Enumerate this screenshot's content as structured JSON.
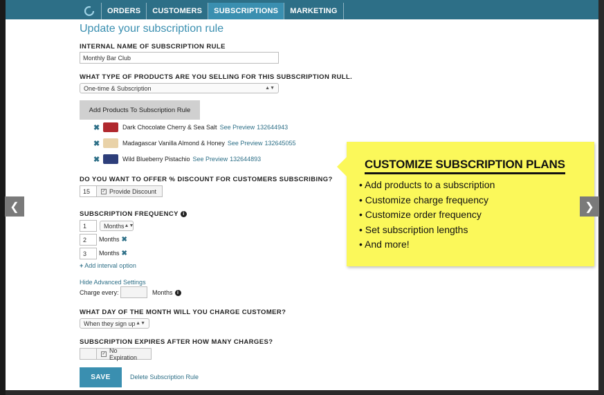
{
  "nav": {
    "items": [
      "ORDERS",
      "CUSTOMERS",
      "SUBSCRIPTIONS",
      "MARKETING"
    ],
    "active": "SUBSCRIPTIONS"
  },
  "page": {
    "title": "Update your subscription rule"
  },
  "form": {
    "internal_name_label": "INTERNAL NAME OF SUBSCRIPTION RULE",
    "internal_name_value": "Monthly Bar Club",
    "product_type_label": "WHAT TYPE OF PRODUCTS ARE YOU SELLING FOR THIS SUBSCRIPTION RULL.",
    "product_type_value": "One-time & Subscription",
    "add_products_button": "Add Products To Subscription Rule",
    "products": [
      {
        "name": "Dark Chocolate Cherry & Sea Salt",
        "preview": "See Preview",
        "id": "132644943",
        "color": "#b0282e"
      },
      {
        "name": "Madagascar Vanilla Almond & Honey",
        "preview": "See Preview",
        "id": "132645055",
        "color": "#e9d2a8"
      },
      {
        "name": "Wild Blueberry Pistachio",
        "preview": "See Preview",
        "id": "132644893",
        "color": "#2d3e7a"
      }
    ],
    "discount_label": "DO YOU WANT TO OFFER % DISCOUNT FOR CUSTOMERS SUBSCRIBING?",
    "discount_value": "15",
    "discount_checkbox": "Provide Discount",
    "frequency_label": "SUBSCRIPTION FREQUENCY",
    "frequencies": [
      {
        "value": "1",
        "unit": "Months"
      },
      {
        "value": "2",
        "unit": "Months"
      },
      {
        "value": "3",
        "unit": "Months"
      }
    ],
    "add_interval": "Add interval option",
    "hide_advanced": "Hide Advanced Settings",
    "charge_every_label": "Charge every:",
    "charge_every_unit": "Months",
    "charge_day_label": "WHAT DAY OF THE MONTH WILL YOU CHARGE CUSTOMER?",
    "charge_day_value": "When they sign up",
    "expires_label": "SUBSCRIPTION EXPIRES AFTER HOW MANY CHARGES?",
    "expires_checkbox": "No Expiration",
    "save_button": "SAVE",
    "delete_link": "Delete Subscription Rule"
  },
  "callout": {
    "title": "CUSTOMIZE SUBSCRIPTION PLANS",
    "bullets": [
      "Add products to a subscription",
      "Customize charge frequency",
      "Customize order frequency",
      "Set subscription lengths",
      "And more!"
    ]
  },
  "colors": {
    "brand": "#2d6f87",
    "accent": "#3a8fb0",
    "callout": "#fbf85a"
  }
}
